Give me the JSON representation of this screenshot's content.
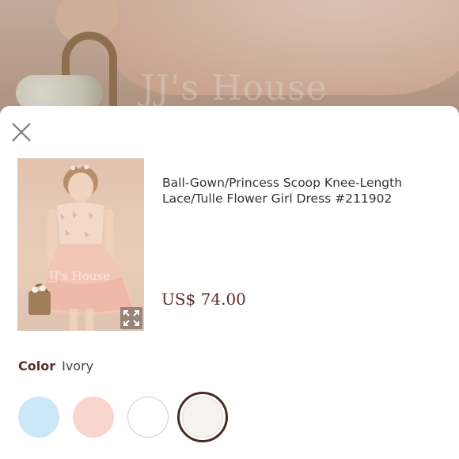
{
  "backdrop": {
    "watermark": "JJ's House"
  },
  "sheet": {
    "close_icon": "close-icon",
    "product": {
      "title": "Ball-Gown/Princess Scoop Knee-Length Lace/Tulle Flower Girl Dress #211902",
      "price": "US$ 74.00",
      "thumbnail_watermark": "JJ's House",
      "expand_icon": "expand-icon"
    },
    "color": {
      "label": "Color",
      "selected_value": "Ivory",
      "swatches": [
        {
          "name": "light-blue",
          "fill": "#cbe7f8",
          "border": "#cbe7f8",
          "selected": false
        },
        {
          "name": "blush",
          "fill": "#f9d6cd",
          "border": "#f9d6cd",
          "selected": false
        },
        {
          "name": "white",
          "fill": "#ffffff",
          "border": "#cfcfcf",
          "selected": false
        },
        {
          "name": "ivory",
          "fill": "#f6f3ec",
          "border": "#e0ddd3",
          "selected": true
        }
      ]
    }
  }
}
